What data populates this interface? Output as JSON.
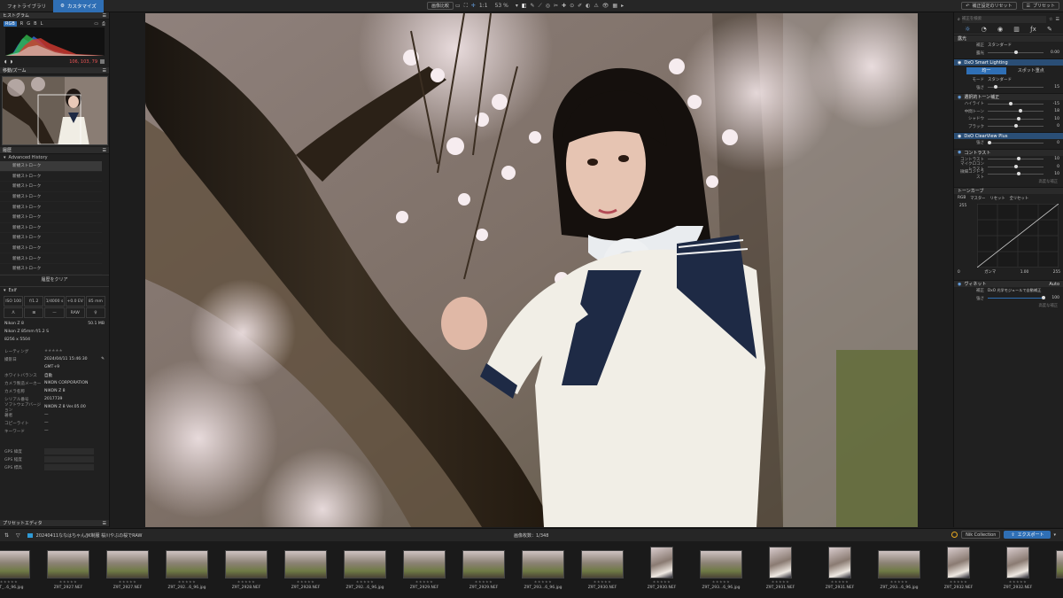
{
  "topbar": {
    "tab_library": "フォトライブラリ",
    "tab_customize": "カスタマイズ",
    "compare_label": "画像比較",
    "zoom_fit": "1:1",
    "zoom_level": "53 %",
    "reset_label": "補正設定のリセット",
    "preset_label": "プリセット"
  },
  "left": {
    "histogram_title": "ヒストグラム",
    "channels": [
      "RGB",
      "R",
      "G",
      "B",
      "L"
    ],
    "hist_readout": "106, 103, 79",
    "nav_title": "移動/ズーム",
    "history_title": "履歴",
    "history_sub": "Advanced History",
    "history_items": [
      "新規ストローク",
      "新規ストローク",
      "新規ストローク",
      "新規ストローク",
      "新規ストローク",
      "新規ストローク",
      "新規ストローク",
      "新規ストローク",
      "新規ストローク",
      "新規ストローク",
      "新規ストローク"
    ],
    "clear_history": "履歴をクリア",
    "exif_title": "Exif",
    "exif_row1": [
      "ISO 100",
      "f/1.2",
      "1/4000 s",
      "+0.0 EV",
      "85 mm"
    ],
    "exif_row2": [
      "Λ",
      "⊞",
      "—",
      "RAW",
      "♀"
    ],
    "camera": "Nikon Z 8",
    "filesize": "50.1 MB",
    "lens": "Nikon Z 85mm f/1.2 S",
    "dimensions": "8256 x 5504",
    "meta": [
      {
        "k": "レーティング",
        "v": "★★★★★"
      },
      {
        "k": "撮影日",
        "v": "2024/04/11 15:46:30"
      },
      {
        "k": "",
        "v": "GMT+9"
      },
      {
        "k": "ホワイトバランス",
        "v": "自動"
      },
      {
        "k": "カメラ製造メーカー",
        "v": "NIKON CORPORATION"
      },
      {
        "k": "カメラ名称",
        "v": "NIKON Z 8"
      },
      {
        "k": "シリアル番号",
        "v": "2017739"
      },
      {
        "k": "ソフトウェアバージョン",
        "v": "NIKON Z 8 Ver.05.00"
      },
      {
        "k": "著者",
        "v": "—"
      },
      {
        "k": "コピーライト",
        "v": "—"
      },
      {
        "k": "キーワード",
        "v": "—"
      }
    ],
    "gps": [
      "GPS 緯度",
      "GPS 経度",
      "GPS 標高"
    ],
    "preset_editor": "プリセットエディタ"
  },
  "right": {
    "search_placeholder": "補正を検索",
    "basic_title": "露光",
    "basic_row1_label": "補正",
    "basic_row1_value": "スタンダード",
    "exposure_label": "露光",
    "exposure_value": "0.00",
    "exposure_level": 0.5,
    "smart_lighting": "DxO Smart Lighting",
    "uniform_btn": "均一",
    "spot_btn": "スポット重点",
    "mode_label": "モード",
    "mode_value": "スタンダード",
    "strength_label": "強さ",
    "strength_value": "15",
    "strength_level": 0.15,
    "tone_title": "選択的トーン補正",
    "tone": [
      {
        "label": "ハイライト",
        "value": "-15",
        "level": 0.42
      },
      {
        "label": "中間トーン",
        "value": "18",
        "level": 0.59
      },
      {
        "label": "シャドウ",
        "value": "10",
        "level": 0.55
      },
      {
        "label": "ブラック",
        "value": "0",
        "level": 0.5
      }
    ],
    "clearview": "DxO ClearView Plus",
    "clearview_label": "強さ",
    "clearview_value": "0",
    "contrast_title": "コントラスト",
    "contrast": [
      {
        "label": "コントラスト",
        "value": "10",
        "level": 0.55
      },
      {
        "label": "マイクロコントラスト",
        "value": "0",
        "level": 0.5
      },
      {
        "label": "微細コントラスト",
        "value": "10",
        "level": 0.55
      }
    ],
    "contrast_adv": "高度な補正",
    "curve_title": "トーンカーブ",
    "curve_tabs": [
      "RGB",
      "マスター",
      "リセット",
      "全リセット"
    ],
    "curve_top": "255",
    "curve_bottom_left": "0",
    "curve_bottom_right": "255",
    "curve_gamma_label": "ガンマ",
    "curve_gamma_value": "1.00",
    "vignette_title": "ヴィネット",
    "vignette_mode": "Auto",
    "vignette_row1_label": "補正",
    "vignette_row1_value": "DxO 光学モジュールで自動補正",
    "vignette_strength_label": "強さ",
    "vignette_strength_value": "100",
    "vignette_level": 1.0,
    "vignette_adv": "高度な補正"
  },
  "bottom": {
    "folder": "20240411ななはちゃん/JK制服 桜川やぶの桜でRAW",
    "count_label": "画像枚数：1/348",
    "nik": "Nik Collection",
    "export": "エクスポート",
    "thumbs": [
      "Z9T_..6_96.jpg",
      "Z9T_2927.NEF",
      "Z9T_2927.NEF",
      "Z9T_292...6_96.jpg",
      "Z9T_2928.NEF",
      "Z9T_2928.NEF",
      "Z9T_292...6_96.jpg",
      "Z9T_2929.NEF",
      "Z9T_2929.NEF",
      "Z9T_293...6_96.jpg",
      "Z9T_2930.NEF",
      "Z9T_2930.NEF",
      "Z9T_293...6_96.jpg",
      "Z9T_2931.NEF",
      "Z9T_2931.NEF",
      "Z9T_293...6_96.jpg",
      "Z9T_2932.NEF",
      "Z9T_2932.NEF",
      "Z9T_293..."
    ]
  }
}
